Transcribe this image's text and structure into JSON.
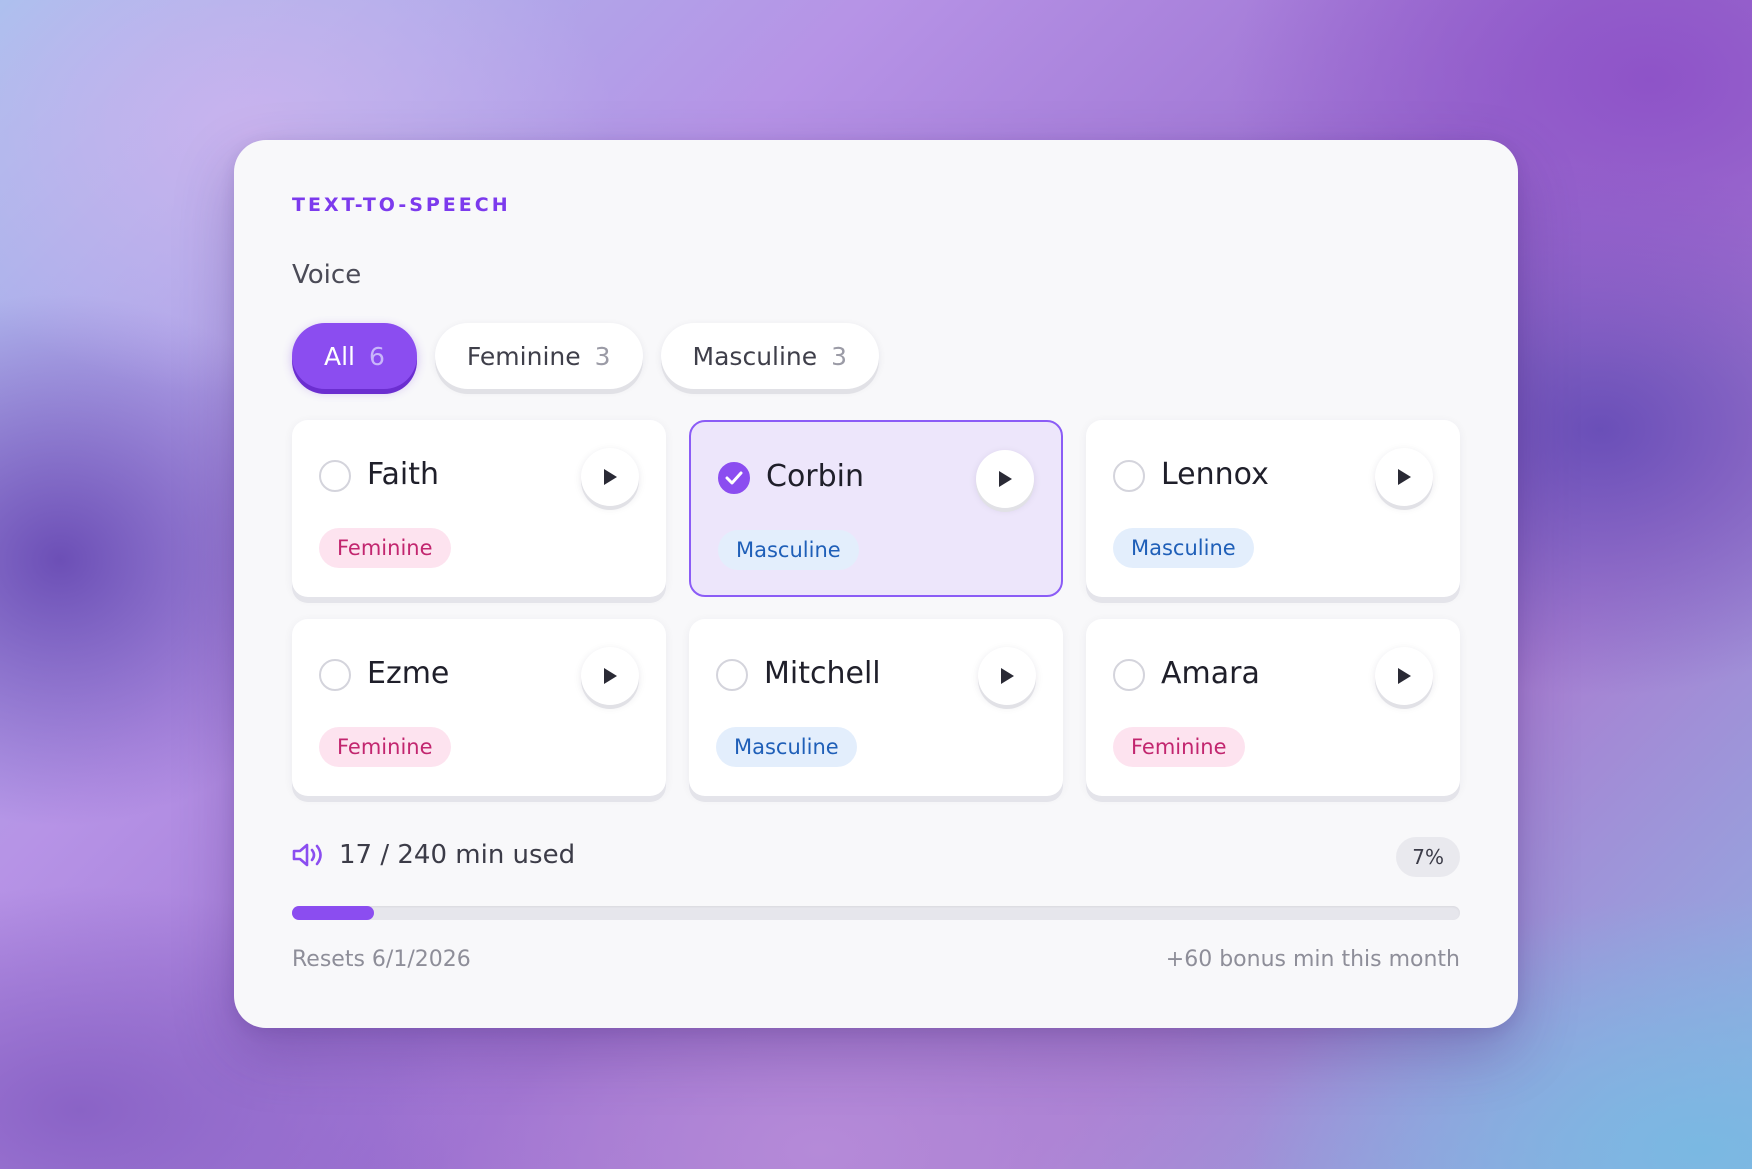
{
  "panel": {
    "eyebrow": "TEXT-TO-SPEECH",
    "section_label": "Voice"
  },
  "filters": [
    {
      "label": "All",
      "count": "6",
      "active": true
    },
    {
      "label": "Feminine",
      "count": "3",
      "active": false
    },
    {
      "label": "Masculine",
      "count": "3",
      "active": false
    }
  ],
  "voices": [
    {
      "name": "Faith",
      "tag": "Feminine",
      "selected": false
    },
    {
      "name": "Corbin",
      "tag": "Masculine",
      "selected": true
    },
    {
      "name": "Lennox",
      "tag": "Masculine",
      "selected": false
    },
    {
      "name": "Ezme",
      "tag": "Feminine",
      "selected": false
    },
    {
      "name": "Mitchell",
      "tag": "Masculine",
      "selected": false
    },
    {
      "name": "Amara",
      "tag": "Feminine",
      "selected": false
    }
  ],
  "usage": {
    "text": "17 / 240 min used",
    "percent_label": "7%",
    "progress": 0.07,
    "resets": "Resets 6/1/2026",
    "bonus": "+60 bonus min this month"
  },
  "colors": {
    "accent": "#8b4df0",
    "feminine_tag_bg": "#fde3ef",
    "feminine_tag_text": "#c2266f",
    "masculine_tag_bg": "#e3eefc",
    "masculine_tag_text": "#1f5fb8"
  },
  "icons": {
    "play": "play-icon",
    "check": "check-icon",
    "speaker": "speaker-icon"
  }
}
